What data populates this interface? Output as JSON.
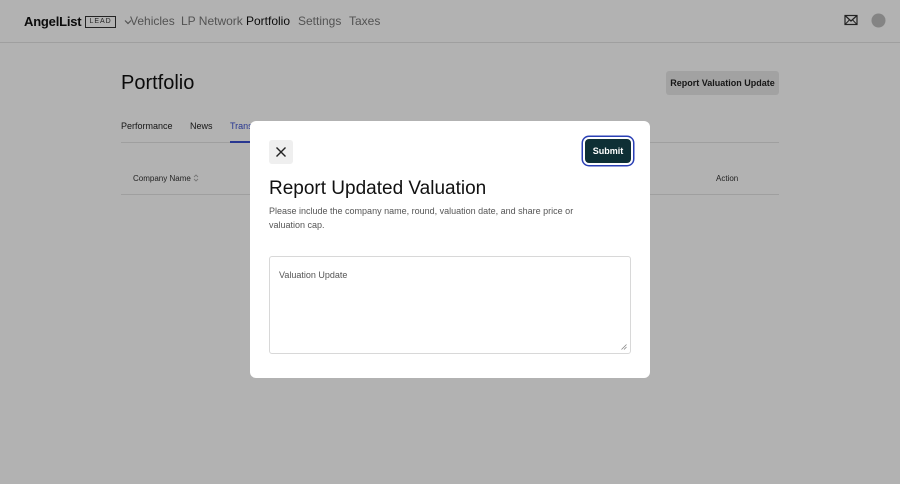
{
  "header": {
    "logo_text": "AngelList",
    "logo_badge": "LEAD",
    "nav": [
      "Vehicles",
      "LP Network",
      "Portfolio",
      "Settings",
      "Taxes"
    ],
    "active_nav": "Portfolio"
  },
  "page": {
    "title": "Portfolio",
    "report_button": "Report Valuation Update"
  },
  "tabs": {
    "items": [
      "Performance",
      "News",
      "Trans"
    ],
    "active": "Trans"
  },
  "table": {
    "columns": {
      "company_name": "Company Name",
      "action": "Action"
    }
  },
  "modal": {
    "title": "Report Updated Valuation",
    "description": "Please include the company name, round, valuation date, and share price or valuation cap.",
    "submit_label": "Submit",
    "textarea_placeholder": "Valuation Update"
  },
  "colors": {
    "primary_dark": "#0e2f35",
    "accent": "#3a4fd0"
  },
  "icons": [
    "chevron-down-icon",
    "mail-icon",
    "avatar",
    "sort-icon",
    "close-icon"
  ]
}
